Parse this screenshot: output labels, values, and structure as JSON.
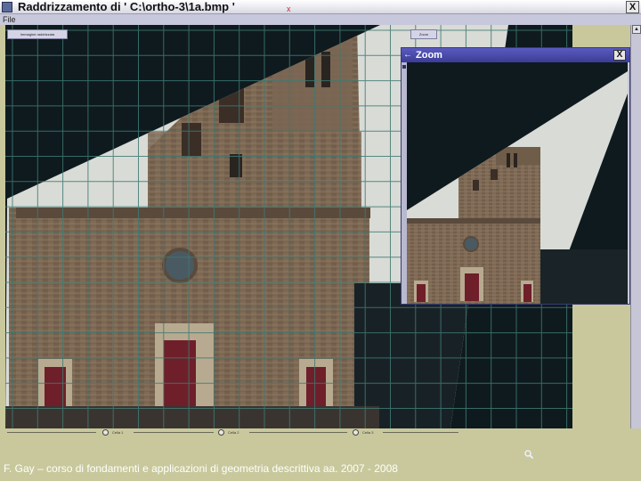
{
  "window": {
    "title": "Raddrizzamento di  ' C:\\ortho-3\\1a.bmp '",
    "title_mark": "x",
    "close_label": "X"
  },
  "menubar": {
    "file_label": "File"
  },
  "toolbar": {
    "left_button_label": "Immagine raddrizzata",
    "zoom_button_label": "Zoom"
  },
  "zoom_window": {
    "title": "Zoom",
    "back_icon": "arrow-left-icon",
    "close_label": "X"
  },
  "scrollbar": {
    "up_arrow": "▲",
    "down_arrow": "▼"
  },
  "statusbar": {
    "cells": [
      "Cella 1",
      "Cella 2",
      "Cella 3"
    ]
  },
  "icons": {
    "magnifier": "magnifier-icon",
    "app": "app-icon"
  },
  "caption": "F. Gay – corso di fondamenti e applicazioni di geometria descrittiva aa. 2007 - 2008",
  "colors": {
    "background": "#c8c89c",
    "zoom_title": "#3c3c96",
    "canvas": "#0e1a1e",
    "stone": "#7a6652",
    "door": "#6e1f2a",
    "grid": "#3f7a72"
  }
}
